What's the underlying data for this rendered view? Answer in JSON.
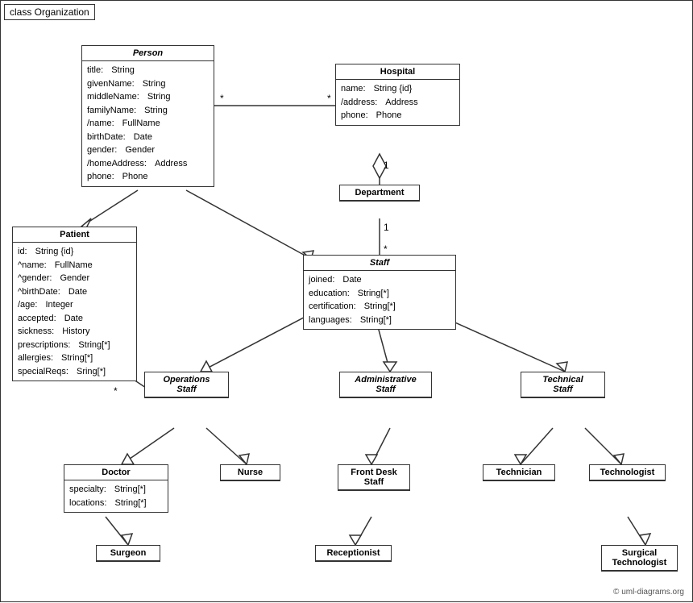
{
  "diagram": {
    "title": "class Organization",
    "classes": {
      "person": {
        "name": "Person",
        "italic": true,
        "attrs": [
          {
            "name": "title:",
            "type": "String"
          },
          {
            "name": "givenName:",
            "type": "String"
          },
          {
            "name": "middleName:",
            "type": "String"
          },
          {
            "name": "familyName:",
            "type": "String"
          },
          {
            "name": "/name:",
            "type": "FullName"
          },
          {
            "name": "birthDate:",
            "type": "Date"
          },
          {
            "name": "gender:",
            "type": "Gender"
          },
          {
            "name": "/homeAddress:",
            "type": "Address"
          },
          {
            "name": "phone:",
            "type": "Phone"
          }
        ]
      },
      "hospital": {
        "name": "Hospital",
        "italic": false,
        "attrs": [
          {
            "name": "name:",
            "type": "String {id}"
          },
          {
            "name": "/address:",
            "type": "Address"
          },
          {
            "name": "phone:",
            "type": "Phone"
          }
        ]
      },
      "department": {
        "name": "Department",
        "italic": false,
        "attrs": []
      },
      "staff": {
        "name": "Staff",
        "italic": true,
        "attrs": [
          {
            "name": "joined:",
            "type": "Date"
          },
          {
            "name": "education:",
            "type": "String[*]"
          },
          {
            "name": "certification:",
            "type": "String[*]"
          },
          {
            "name": "languages:",
            "type": "String[*]"
          }
        ]
      },
      "patient": {
        "name": "Patient",
        "italic": false,
        "attrs": [
          {
            "name": "id:",
            "type": "String {id}"
          },
          {
            "name": "^name:",
            "type": "FullName"
          },
          {
            "name": "^gender:",
            "type": "Gender"
          },
          {
            "name": "^birthDate:",
            "type": "Date"
          },
          {
            "name": "/age:",
            "type": "Integer"
          },
          {
            "name": "accepted:",
            "type": "Date"
          },
          {
            "name": "sickness:",
            "type": "History"
          },
          {
            "name": "prescriptions:",
            "type": "String[*]"
          },
          {
            "name": "allergies:",
            "type": "String[*]"
          },
          {
            "name": "specialReqs:",
            "type": "Sring[*]"
          }
        ]
      },
      "operations_staff": {
        "name": "Operations\nStaff",
        "italic": true,
        "attrs": []
      },
      "administrative_staff": {
        "name": "Administrative\nStaff",
        "italic": true,
        "attrs": []
      },
      "technical_staff": {
        "name": "Technical\nStaff",
        "italic": true,
        "attrs": []
      },
      "doctor": {
        "name": "Doctor",
        "italic": false,
        "attrs": [
          {
            "name": "specialty:",
            "type": "String[*]"
          },
          {
            "name": "locations:",
            "type": "String[*]"
          }
        ]
      },
      "nurse": {
        "name": "Nurse",
        "italic": false,
        "attrs": []
      },
      "front_desk_staff": {
        "name": "Front Desk\nStaff",
        "italic": false,
        "attrs": []
      },
      "technician": {
        "name": "Technician",
        "italic": false,
        "attrs": []
      },
      "technologist": {
        "name": "Technologist",
        "italic": false,
        "attrs": []
      },
      "surgeon": {
        "name": "Surgeon",
        "italic": false,
        "attrs": []
      },
      "receptionist": {
        "name": "Receptionist",
        "italic": false,
        "attrs": []
      },
      "surgical_technologist": {
        "name": "Surgical\nTechnologist",
        "italic": false,
        "attrs": []
      }
    },
    "copyright": "© uml-diagrams.org"
  }
}
